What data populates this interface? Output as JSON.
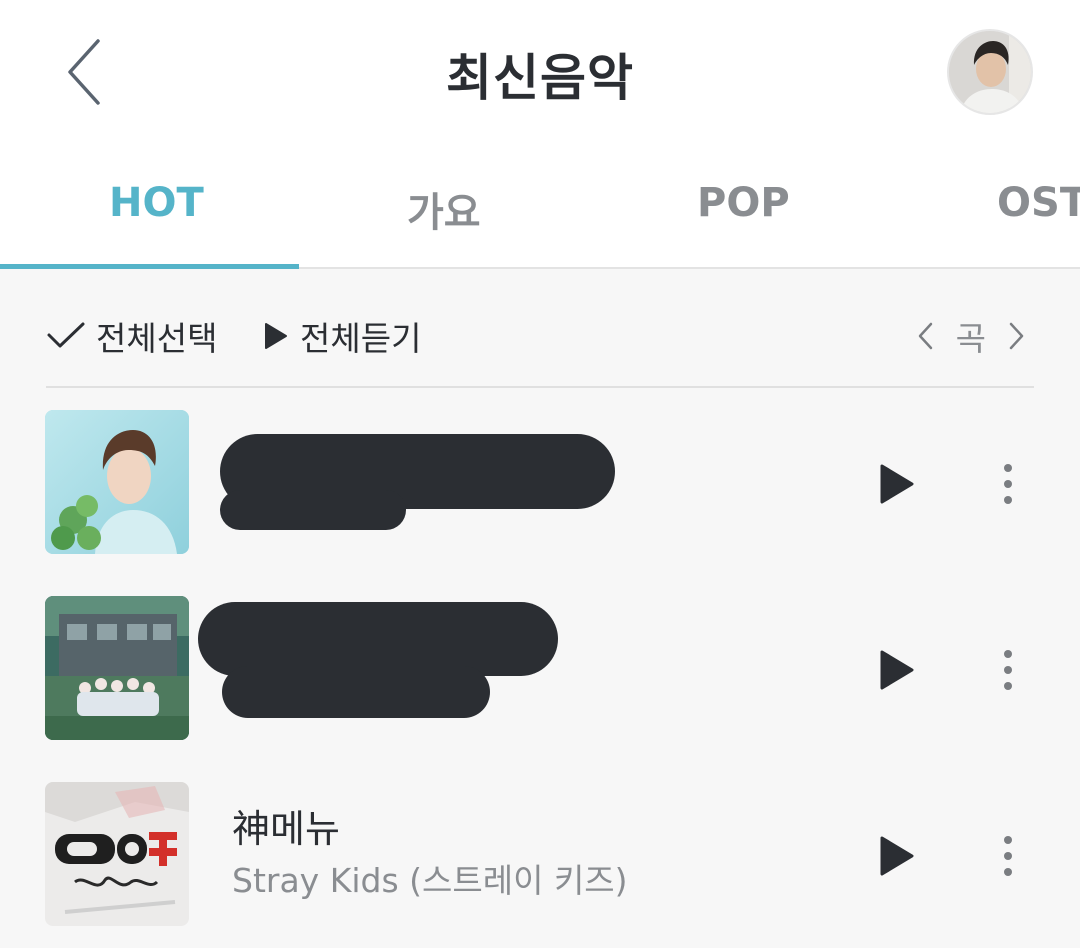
{
  "header": {
    "title": "최신음악",
    "back_icon": "chevron-left-icon",
    "avatar": "user-avatar"
  },
  "tabs": [
    {
      "label": "HOT",
      "active": true
    },
    {
      "label": "가요",
      "active": false
    },
    {
      "label": "POP",
      "active": false
    },
    {
      "label": "OST",
      "active": false
    }
  ],
  "toolbar": {
    "select_all_label": "전체선택",
    "play_all_label": "전체듣기",
    "pager_label": "곡"
  },
  "songs": [
    {
      "title": "",
      "artist": "",
      "redacted": true
    },
    {
      "title": "",
      "artist": "",
      "redacted": true
    },
    {
      "title": "神메뉴",
      "artist": "Stray Kids (스트레이 키즈)",
      "redacted": false
    }
  ],
  "colors": {
    "accent": "#55b4c9",
    "text": "#2b2e33",
    "muted": "#8a8d91",
    "background": "#f7f7f7"
  }
}
